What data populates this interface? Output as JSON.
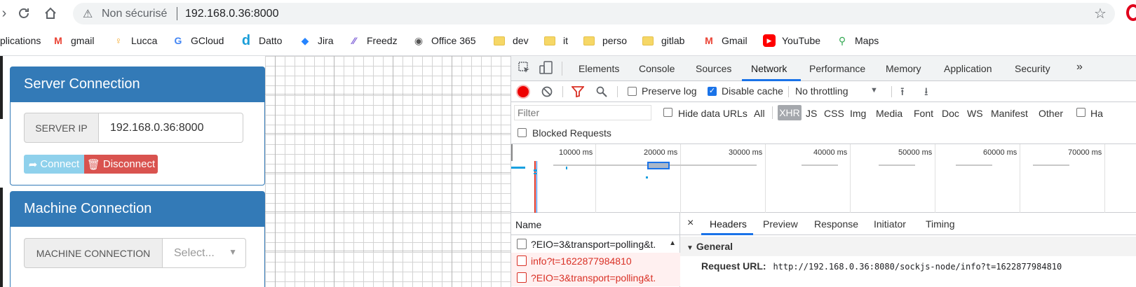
{
  "browser": {
    "security_label": "Non sécurisé",
    "url": "192.168.0.36:8000"
  },
  "bookmarks": [
    {
      "label": "plications",
      "icon": "apps-icon"
    },
    {
      "label": "gmail",
      "icon": "gmail-icon"
    },
    {
      "label": "Lucca",
      "icon": "lucca-icon"
    },
    {
      "label": "GCloud",
      "icon": "google-icon"
    },
    {
      "label": "Datto",
      "icon": "datto-icon"
    },
    {
      "label": "Jira",
      "icon": "jira-icon"
    },
    {
      "label": "Freedz",
      "icon": "freedz-icon"
    },
    {
      "label": "Office 365",
      "icon": "globe-icon"
    },
    {
      "label": "dev",
      "icon": "folder-icon"
    },
    {
      "label": "it",
      "icon": "folder-icon"
    },
    {
      "label": "perso",
      "icon": "folder-icon"
    },
    {
      "label": "gitlab",
      "icon": "folder-icon"
    },
    {
      "label": "Gmail",
      "icon": "gmail-icon"
    },
    {
      "label": "YouTube",
      "icon": "youtube-icon"
    },
    {
      "label": "Maps",
      "icon": "maps-icon"
    }
  ],
  "server_panel": {
    "title": "Server Connection",
    "ip_label": "SERVER IP",
    "ip_value": "192.168.0.36:8000",
    "connect_label": "Connect",
    "disconnect_label": "Disconnect"
  },
  "machine_panel": {
    "title": "Machine Connection",
    "label": "MACHINE CONNECTION",
    "select_placeholder": "Select..."
  },
  "devtools": {
    "tabs": [
      "Elements",
      "Console",
      "Sources",
      "Network",
      "Performance",
      "Memory",
      "Application",
      "Security"
    ],
    "active_tab": "Network",
    "more": "»",
    "preserve_log": "Preserve log",
    "disable_cache": "Disable cache",
    "throttling": "No throttling",
    "filter_placeholder": "Filter",
    "hide_data_urls": "Hide data URLs",
    "types": [
      "All",
      "XHR",
      "JS",
      "CSS",
      "Img",
      "Media",
      "Font",
      "Doc",
      "WS",
      "Manifest",
      "Other"
    ],
    "active_type": "XHR",
    "cut_label": "Ha",
    "blocked_requests": "Blocked Requests",
    "timeline_labels": [
      "10000 ms",
      "20000 ms",
      "30000 ms",
      "40000 ms",
      "50000 ms",
      "60000 ms",
      "70000 ms"
    ],
    "name_header": "Name",
    "requests": [
      {
        "name": "?EIO=3&transport=polling&t.",
        "error": false
      },
      {
        "name": "info?t=1622877984810",
        "error": true
      },
      {
        "name": "?EIO=3&transport=polling&t.",
        "error": true
      }
    ],
    "detail_tabs": [
      "Headers",
      "Preview",
      "Response",
      "Initiator",
      "Timing"
    ],
    "active_detail_tab": "Headers",
    "close": "×",
    "general": "General",
    "request_url_label": "Request URL:",
    "request_url": "http://192.168.0.36:8080/sockjs-node/info?t=1622877984810"
  }
}
